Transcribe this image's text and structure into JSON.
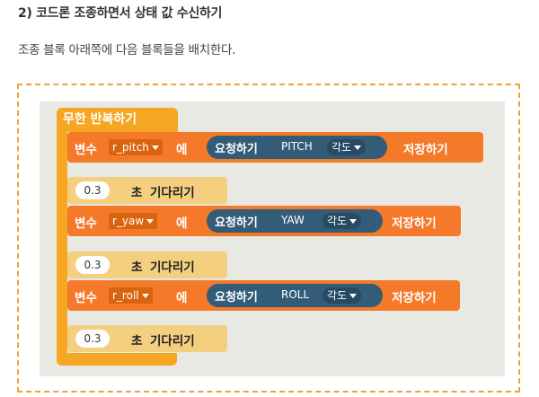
{
  "heading": "2) 코드론 조종하면서 상태 값 수신하기",
  "description": "조종 블록 아래쪽에 다음 블록들을 배치한다.",
  "loop": {
    "label": "무한 반복하기"
  },
  "rows": [
    {
      "var_kw": "변수",
      "var_name": "r_pitch",
      "eq_kw": "에",
      "request_kw": "요청하기",
      "param": "PITCH",
      "angle": "각도",
      "save_kw": "저장하기",
      "wait_value": "0.3",
      "wait_unit": "초",
      "wait_kw": "기다리기"
    },
    {
      "var_kw": "변수",
      "var_name": "r_yaw",
      "eq_kw": "에",
      "request_kw": "요청하기",
      "param": "YAW",
      "angle": "각도",
      "save_kw": "저장하기",
      "wait_value": "0.3",
      "wait_unit": "초",
      "wait_kw": "기다리기"
    },
    {
      "var_kw": "변수",
      "var_name": "r_roll",
      "eq_kw": "에",
      "request_kw": "요청하기",
      "param": "ROLL",
      "angle": "각도",
      "save_kw": "저장하기",
      "wait_value": "0.3",
      "wait_unit": "초",
      "wait_kw": "기다리기"
    }
  ],
  "colors": {
    "frame_border": "#f0a13a",
    "loop_block": "#f5a623",
    "variable_block": "#f47a2a",
    "request_pill": "#335c79",
    "wait_block": "#f3cf7f"
  }
}
